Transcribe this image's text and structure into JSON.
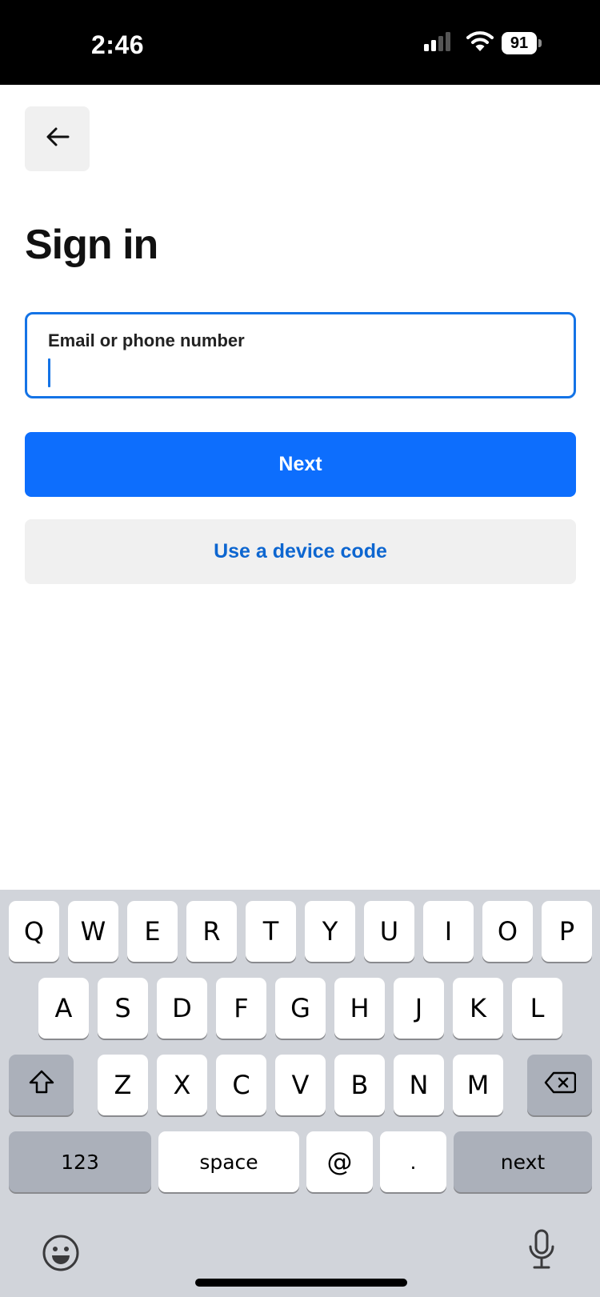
{
  "status_bar": {
    "time": "2:46",
    "battery_level": "91",
    "icons": [
      "cellular-signal-icon",
      "wifi-icon",
      "battery-icon"
    ]
  },
  "header": {
    "back_icon": "arrow-left-icon"
  },
  "page": {
    "title": "Sign in"
  },
  "form": {
    "email_label": "Email or phone number",
    "email_value": "",
    "next_label": "Next",
    "device_code_label": "Use a device code"
  },
  "keyboard": {
    "row1": [
      "Q",
      "W",
      "E",
      "R",
      "T",
      "Y",
      "U",
      "I",
      "O",
      "P"
    ],
    "row2": [
      "A",
      "S",
      "D",
      "F",
      "G",
      "H",
      "J",
      "K",
      "L"
    ],
    "row3": [
      "Z",
      "X",
      "C",
      "V",
      "B",
      "N",
      "M"
    ],
    "numbers_label": "123",
    "space_label": "space",
    "at_label": "@",
    "dot_label": ".",
    "return_label": "next",
    "icons": [
      "shift-icon",
      "backspace-icon",
      "emoji-icon",
      "microphone-icon"
    ]
  },
  "colors": {
    "accent": "#0d6efd",
    "focus_border": "#1473e6",
    "link_text": "#0d66d0",
    "keyboard_bg": "#d1d4da"
  }
}
